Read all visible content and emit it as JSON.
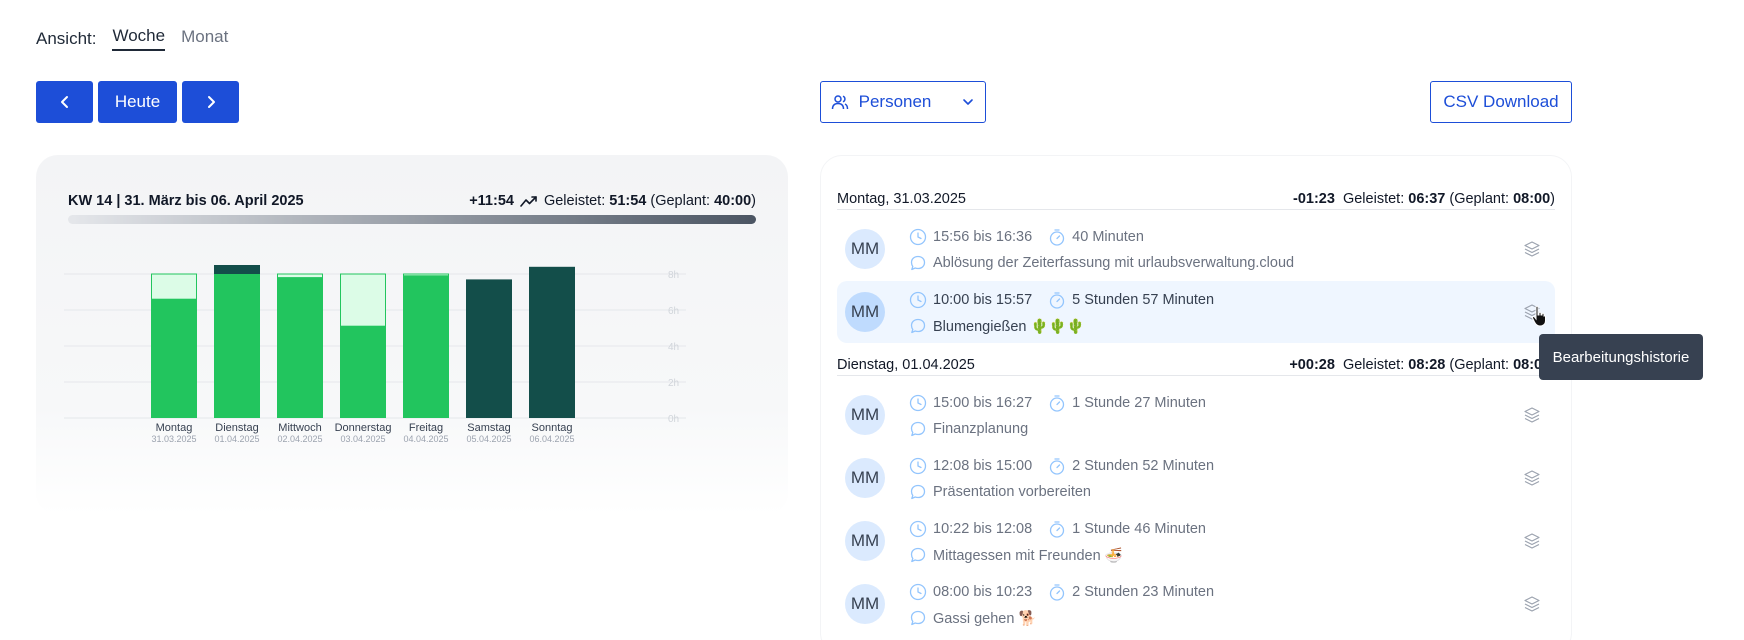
{
  "view": {
    "label": "Ansicht:",
    "tabs": [
      "Woche",
      "Monat"
    ],
    "active": "Woche"
  },
  "nav": {
    "prev_icon": "chevron-left-icon",
    "today": "Heute",
    "next_icon": "chevron-right-icon"
  },
  "persons_button": "Personen",
  "csv_button": "CSV Download",
  "week": {
    "title": "KW 14 | 31. März bis 06. April 2025",
    "delta": "+11:54",
    "worked_label": "Geleistet:",
    "worked": "51:54",
    "planned_label": "(Geplant:",
    "planned": "40:00",
    "planned_close": ")"
  },
  "chart_data": {
    "type": "bar",
    "categories": [
      "Montag",
      "Dienstag",
      "Mittwoch",
      "Donnerstag",
      "Freitag",
      "Samstag",
      "Sonntag"
    ],
    "dates": [
      "31.03.2025",
      "01.04.2025",
      "02.04.2025",
      "03.04.2025",
      "04.04.2025",
      "05.04.2025",
      "06.04.2025"
    ],
    "series": [
      {
        "values": [
          6.6,
          8.0,
          7.8,
          5.1,
          7.9,
          0,
          0
        ]
      },
      {
        "values": [
          1.4,
          0,
          0.2,
          2.9,
          0.1,
          0,
          0
        ]
      },
      {
        "values": [
          0,
          0.5,
          0,
          0,
          0,
          7.7,
          8.4
        ]
      }
    ],
    "yticks": [
      "0h",
      "2h",
      "4h",
      "6h",
      "8h"
    ],
    "ylim": [
      0,
      8
    ],
    "grid": true,
    "colors": {
      "worked": "#22c55e",
      "remaining": "#dcfce7",
      "overtime": "#134e4a",
      "weekend": "#134e4a"
    }
  },
  "days": [
    {
      "date": "Montag, 31.03.2025",
      "delta": "-01:23",
      "worked_label": "Geleistet:",
      "worked": "06:37",
      "planned_label": "(Geplant:",
      "planned": "08:00",
      "planned_close": ")",
      "entries": [
        {
          "initials": "MM",
          "time": "15:56 bis 16:36",
          "duration": "40 Minuten",
          "desc": "Ablösung der Zeiterfassung mit urlaubsverwaltung.cloud"
        },
        {
          "initials": "MM",
          "time": "10:00 bis 15:57",
          "duration": "5 Stunden 57 Minuten",
          "desc": "Blumengießen 🌵🌵🌵"
        }
      ]
    },
    {
      "date": "Dienstag, 01.04.2025",
      "delta": "+00:28",
      "worked_label": "Geleistet:",
      "worked": "08:28",
      "planned_label": "(Geplant:",
      "planned": "08:00",
      "planned_close": ")",
      "entries": [
        {
          "initials": "MM",
          "time": "15:00 bis 16:27",
          "duration": "1 Stunde 27 Minuten",
          "desc": "Finanzplanung"
        },
        {
          "initials": "MM",
          "time": "12:08 bis 15:00",
          "duration": "2 Stunden 52 Minuten",
          "desc": "Präsentation vorbereiten"
        },
        {
          "initials": "MM",
          "time": "10:22 bis 12:08",
          "duration": "1 Stunde 46 Minuten",
          "desc": "Mittagessen mit Freunden 🍜"
        },
        {
          "initials": "MM",
          "time": "08:00 bis 10:23",
          "duration": "2 Stunden 23 Minuten",
          "desc": "Gassi gehen 🐕"
        }
      ]
    }
  ],
  "tooltip": "Bearbeitungshistorie"
}
